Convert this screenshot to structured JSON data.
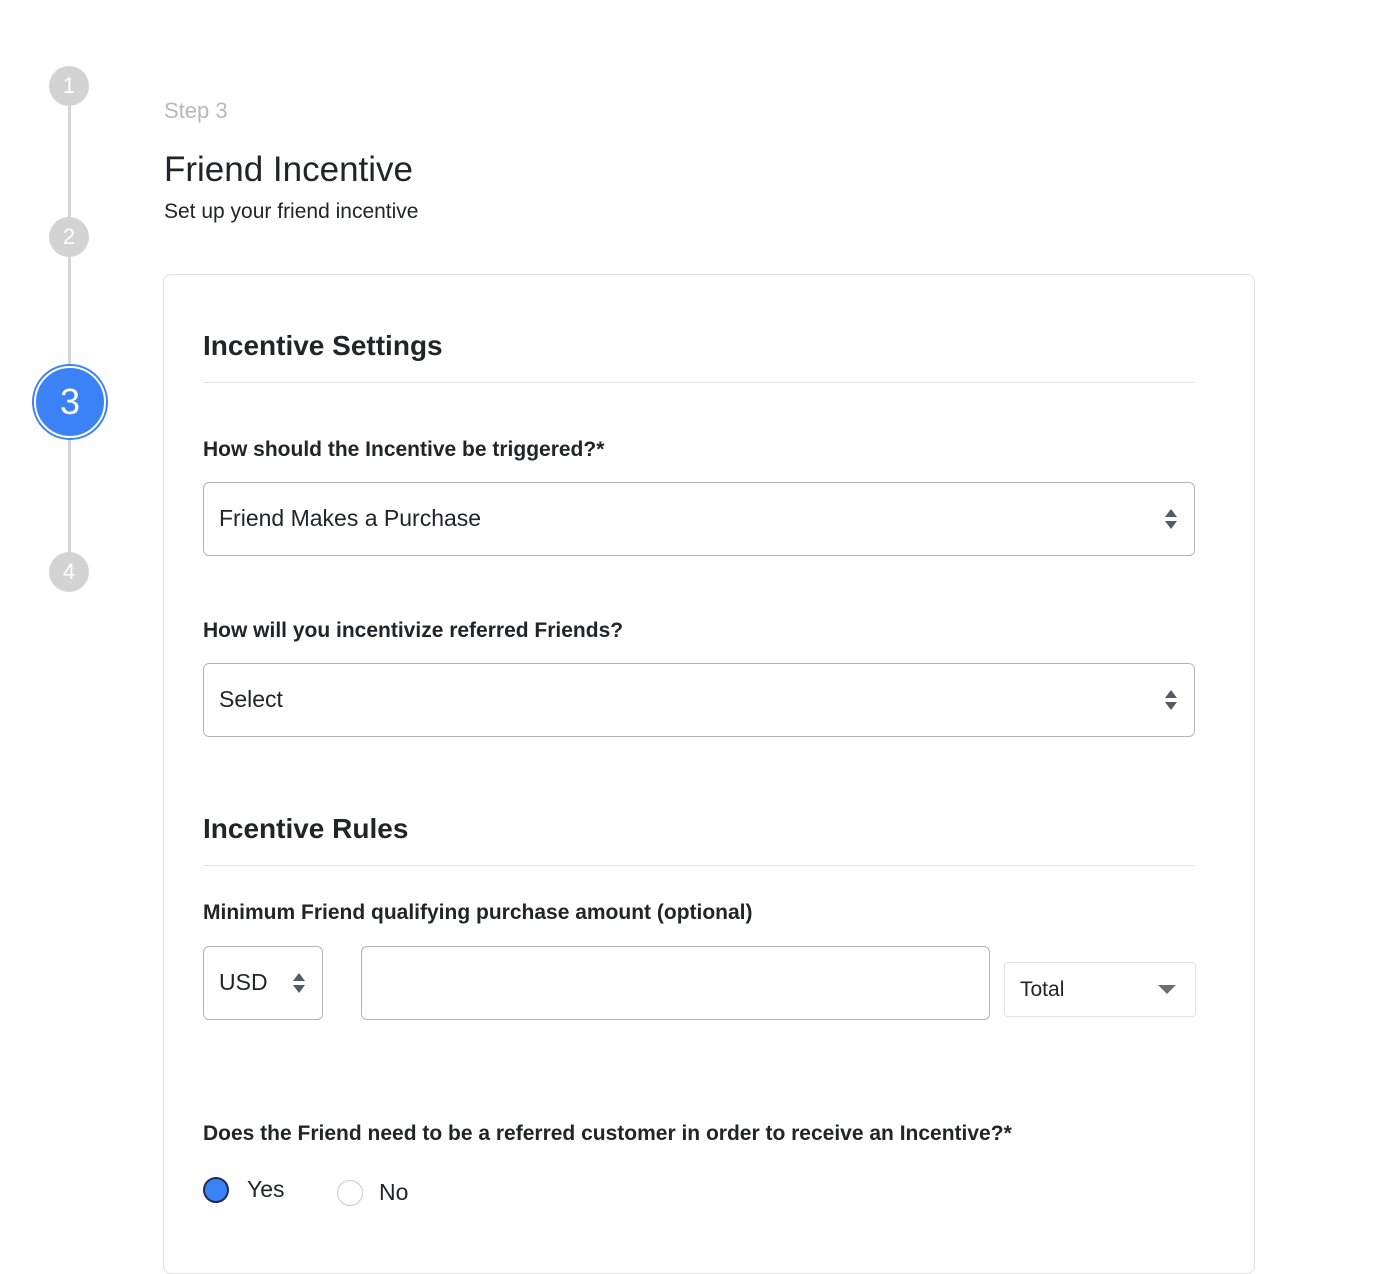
{
  "stepper": {
    "steps": [
      "1",
      "2",
      "3",
      "4"
    ],
    "active_step": "3"
  },
  "header": {
    "step_label": "Step 3",
    "title": "Friend Incentive",
    "subtitle": "Set up your friend incentive"
  },
  "incentive_settings": {
    "title": "Incentive Settings",
    "trigger_label": "How should the Incentive be triggered?*",
    "trigger_value": "Friend Makes a Purchase",
    "incentivize_label": "How will you incentivize referred Friends?",
    "incentivize_value": "Select"
  },
  "incentive_rules": {
    "title": "Incentive Rules",
    "min_purchase_label": "Minimum Friend qualifying purchase amount (optional)",
    "currency_value": "USD",
    "amount_value": "",
    "total_value": "Total",
    "referred_label": "Does the Friend need to be a referred customer in order to receive an Incentive?*",
    "options": [
      {
        "label": "Yes",
        "selected": true
      },
      {
        "label": "No",
        "selected": false
      }
    ]
  },
  "colors": {
    "accent": "#3b82f6",
    "inactive_step": "#d3d3d3",
    "border": "#b5b5b5"
  }
}
